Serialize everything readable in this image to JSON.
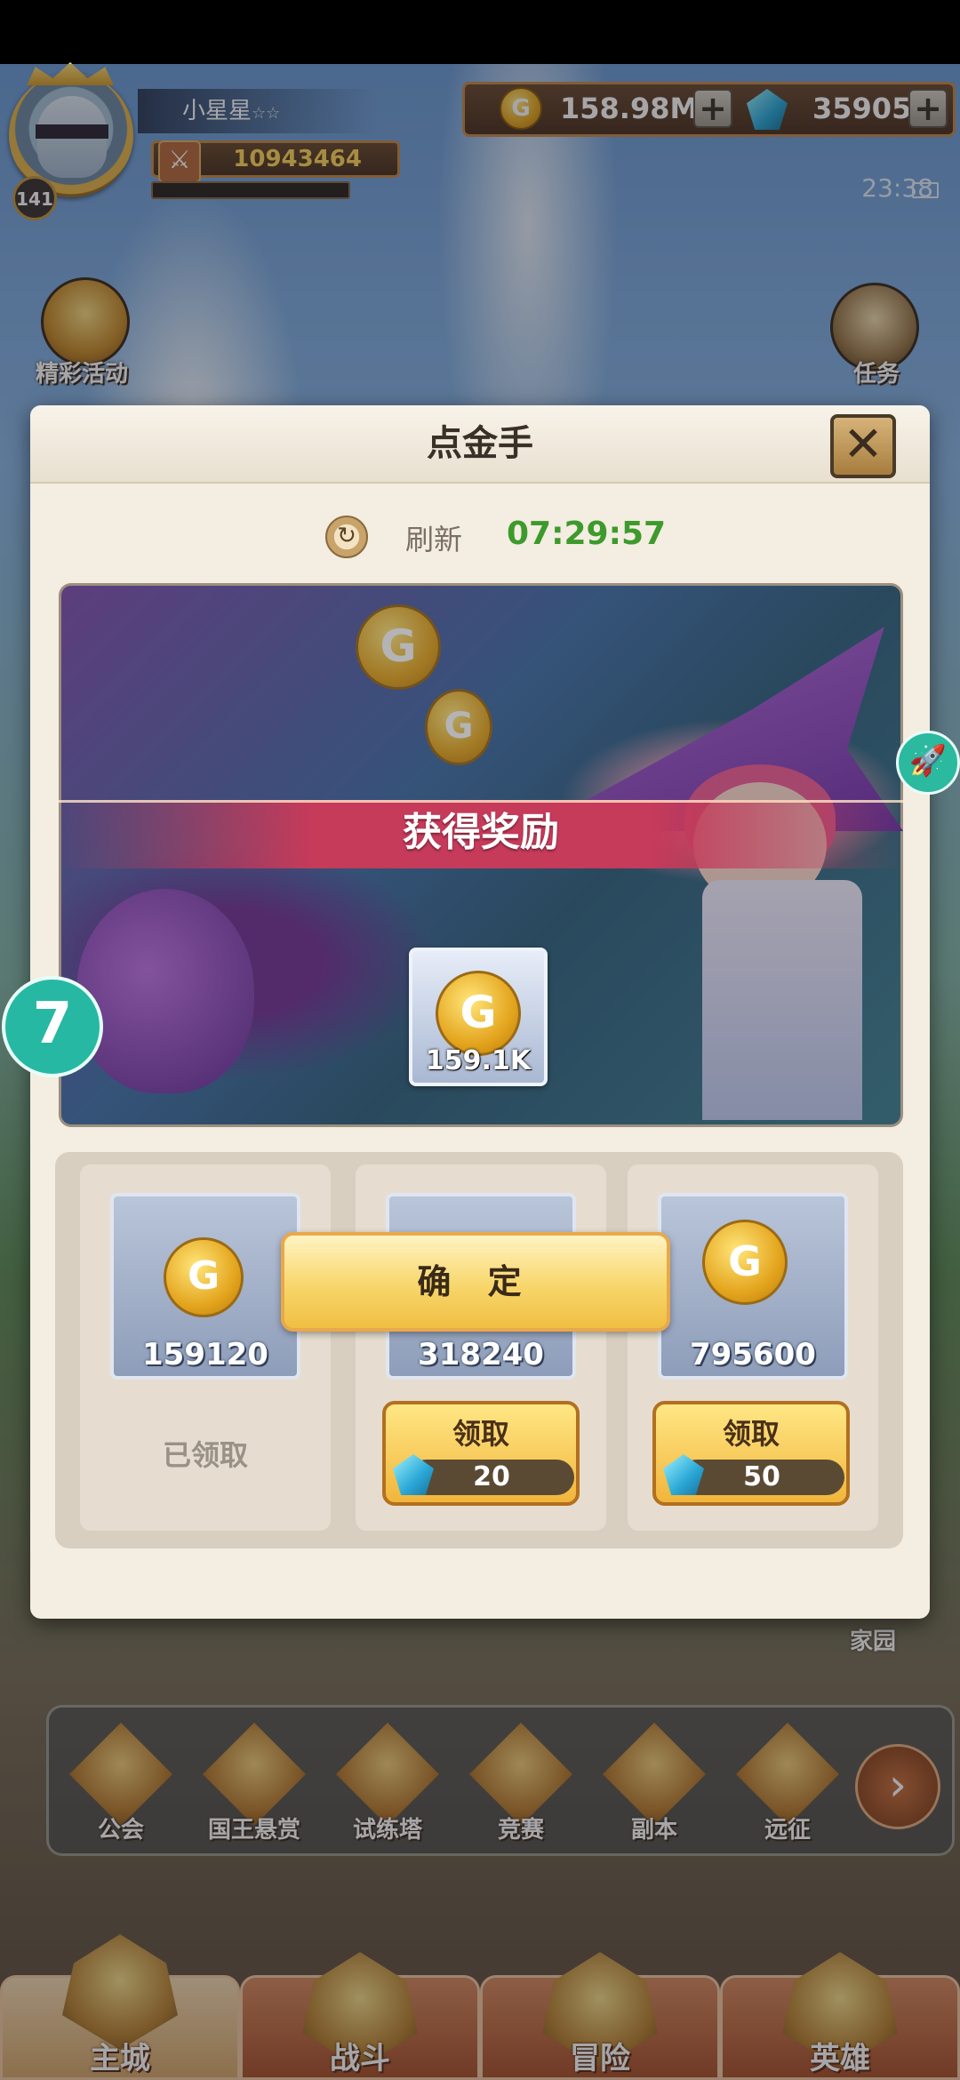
{
  "hud": {
    "player_name": "小星星",
    "player_stars": "☆☆",
    "level": "141",
    "power": "10943464",
    "gold": "158.98M",
    "gems": "35905",
    "time": "23:38"
  },
  "side_buttons": {
    "events": "精彩活动",
    "tasks": "任务"
  },
  "dialog": {
    "title": "点金手",
    "refresh_label": "刷新",
    "refresh_time": "07:29:57",
    "reward_title": "获得奖励",
    "reward_amount": "159.1K",
    "confirm": "确 定",
    "options": [
      {
        "amount": "159120",
        "status": "已领取"
      },
      {
        "amount": "318240",
        "button": "领取",
        "cost": "20"
      },
      {
        "amount": "795600",
        "button": "领取",
        "cost": "50"
      }
    ]
  },
  "floating": {
    "seven_label": "7",
    "home": "家园"
  },
  "features": [
    "公会",
    "国王悬赏",
    "试练塔",
    "竞赛",
    "副本",
    "远征"
  ],
  "nav": {
    "tabs": [
      "主城",
      "战斗",
      "冒险",
      "英雄"
    ],
    "active": "主城"
  },
  "colors": {
    "refresh_time": "#3d9a2c",
    "reward_band": "#c63a5a",
    "gold_accent": "#f1b53b"
  },
  "icons": [
    "gold-coin-icon",
    "gem-icon",
    "plus-icon",
    "close-icon",
    "refresh-icon",
    "rocket-icon",
    "next-arrow-icon"
  ]
}
